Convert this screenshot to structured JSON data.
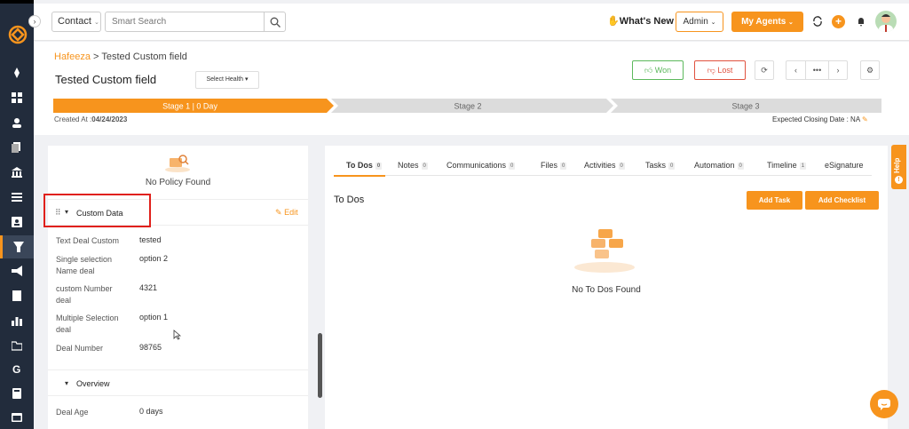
{
  "topbar": {
    "contact_select": "Contact",
    "search_placeholder": "Smart Search",
    "whats_new": "What's New",
    "admin": "Admin",
    "my_agents": "My Agents"
  },
  "breadcrumb": {
    "parent": "Hafeeza",
    "separator": " > ",
    "current": "Tested Custom field"
  },
  "deal": {
    "title": "Tested Custom field",
    "health_select": "Select Health",
    "won_label": "Won",
    "lost_label": "Lost",
    "created_at_label": "Created At :",
    "created_at_value": "04/24/2023",
    "closing_label": "Expected Closing Date : NA"
  },
  "stages": [
    {
      "label": "Stage 1 | 0 Day",
      "active": true
    },
    {
      "label": "Stage 2",
      "active": false
    },
    {
      "label": "Stage 3",
      "active": false
    }
  ],
  "left": {
    "no_policy": "No Policy Found",
    "custom_data_label": "Custom Data",
    "edit_label": "Edit",
    "fields": [
      {
        "label": "Text Deal Custom",
        "value": "tested"
      },
      {
        "label": "Single selection Name deal",
        "value": "option 2"
      },
      {
        "label": "custom Number deal",
        "value": "4321"
      },
      {
        "label": "Multiple Selection deal",
        "value": "option 1"
      },
      {
        "label": "Deal Number",
        "value": "98765"
      }
    ],
    "overview_label": "Overview",
    "overview_fields": [
      {
        "label": "Deal Age",
        "value": "0 days"
      }
    ]
  },
  "right": {
    "tabs": [
      {
        "label": "To Dos",
        "count": "0"
      },
      {
        "label": "Notes",
        "count": "0"
      },
      {
        "label": "Communications",
        "count": "0"
      },
      {
        "label": "Files",
        "count": "0"
      },
      {
        "label": "Activities",
        "count": "0"
      },
      {
        "label": "Tasks",
        "count": "0"
      },
      {
        "label": "Automation",
        "count": "0"
      },
      {
        "label": "Timeline",
        "count": "1"
      },
      {
        "label": "eSignature",
        "count": ""
      }
    ],
    "section_title": "To Dos",
    "add_task": "Add Task",
    "add_checklist": "Add Checklist",
    "empty_text": "No To Dos Found"
  },
  "help_label": "Help",
  "colors": {
    "accent": "#f7941d",
    "sidebar": "#222c3c",
    "won": "#5cb85c",
    "lost": "#e0523f"
  }
}
